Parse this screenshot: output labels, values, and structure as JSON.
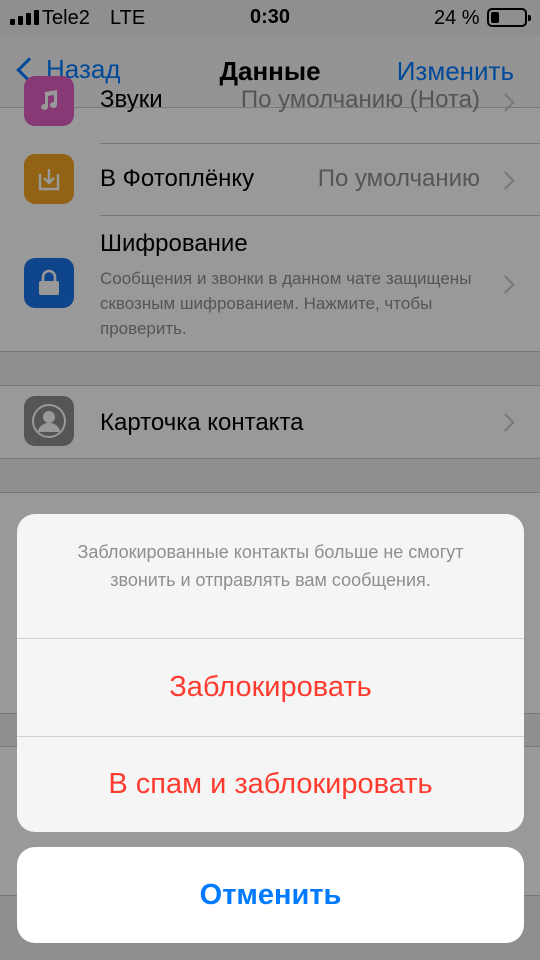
{
  "status_bar": {
    "carrier": "Tele2",
    "network": "LTE",
    "time": "0:30",
    "battery_percent": "24 %"
  },
  "nav": {
    "back_label": "Назад",
    "title": "Данные",
    "edit_label": "Изменить"
  },
  "rows": {
    "sounds": {
      "label": "Звуки",
      "value": "По умолчанию (Нота)",
      "icon": "music-note-icon",
      "color": "#e05fc3"
    },
    "save_to_camera_roll": {
      "label": "В Фотоплёнку",
      "value": "По умолчанию",
      "icon": "download-icon",
      "color": "#f5a623"
    },
    "encryption": {
      "label": "Шифрование",
      "description": "Сообщения и звонки в данном чате защищены сквозным шифрованием. Нажмите, чтобы проверить.",
      "icon": "lock-icon",
      "color": "#1a73e8"
    },
    "contact_card": {
      "label": "Карточка контакта",
      "icon": "contact-icon",
      "color": "#8e8e93"
    }
  },
  "action_sheet": {
    "message": "Заблокированные контакты больше не смогут звонить и отправлять вам сообщения.",
    "block_label": "Заблокировать",
    "report_block_label": "В спам и заблокировать",
    "cancel_label": "Отменить",
    "destructive_color": "#ff3b30",
    "accent_color": "#007aff"
  }
}
